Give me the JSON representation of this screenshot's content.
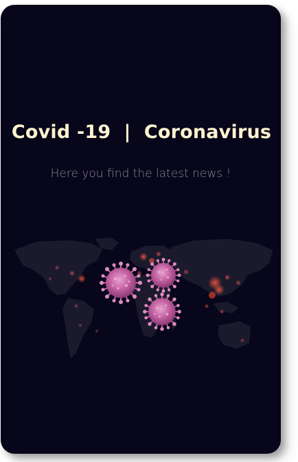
{
  "page": {
    "title": "Covid -19  |  Coronavirus",
    "subtitle": "Here you find the latest news !"
  },
  "illustration": {
    "name": "world-map-virus-illustration",
    "colors": {
      "background": "#07061a",
      "land": "#1c1b2e",
      "hotspot": "#c0392b",
      "virus": "#c86aa8"
    }
  }
}
